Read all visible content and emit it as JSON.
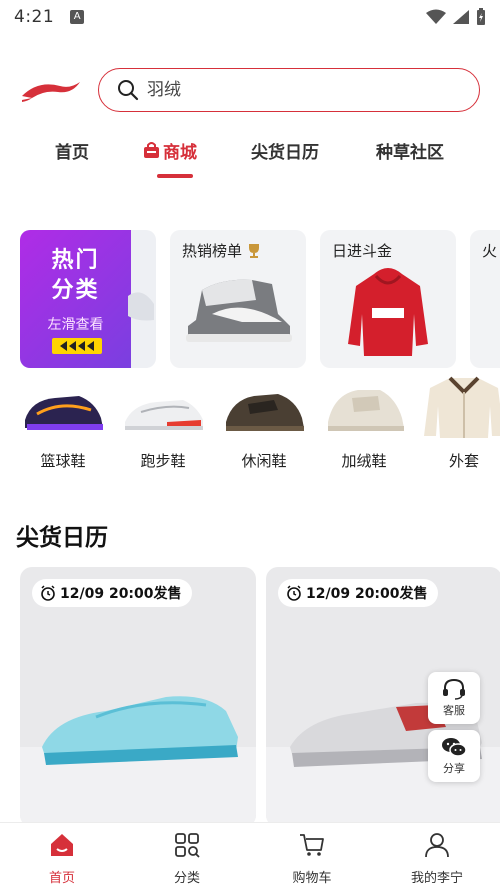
{
  "status": {
    "time": "4:21",
    "app_icon": "A"
  },
  "search": {
    "placeholder": "羽绒"
  },
  "tabs": [
    {
      "label": "首页"
    },
    {
      "label": "商城"
    },
    {
      "label": "尖货日历"
    },
    {
      "label": "种草社区"
    }
  ],
  "active_tab": "商城",
  "features": {
    "hot": {
      "title_line1": "热门",
      "title_line2": "分类",
      "subtitle": "左滑查看"
    },
    "cards": [
      {
        "title": "热销榜单"
      },
      {
        "title": "日进斗金"
      },
      {
        "title": "火"
      }
    ]
  },
  "categories": [
    {
      "label": "篮球鞋"
    },
    {
      "label": "跑步鞋"
    },
    {
      "label": "休闲鞋"
    },
    {
      "label": "加绒鞋"
    },
    {
      "label": "外套"
    }
  ],
  "section": {
    "title": "尖货日历"
  },
  "products": [
    {
      "release": "12/09 20:00发售"
    },
    {
      "release": "12/09 20:00发售"
    }
  ],
  "floating": {
    "service": "客服",
    "share": "分享"
  },
  "nav": [
    {
      "label": "首页"
    },
    {
      "label": "分类"
    },
    {
      "label": "购物车"
    },
    {
      "label": "我的李宁"
    }
  ],
  "colors": {
    "accent": "#d6303a",
    "hot_purple": "#9b35e4",
    "hot_yellow": "#ffd400"
  }
}
